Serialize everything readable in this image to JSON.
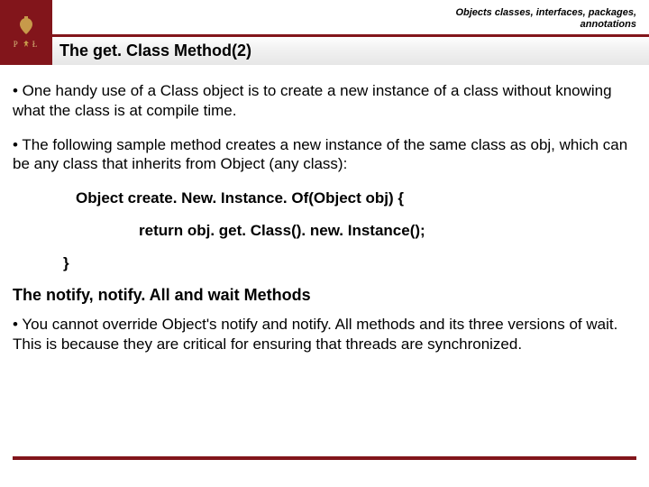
{
  "header": {
    "breadcrumb_line1": "Objects classes, interfaces, packages,",
    "breadcrumb_line2": "annotations",
    "title": "The get. Class Method(2)",
    "logo_letter_left": "P",
    "logo_letter_right": "Ł"
  },
  "body": {
    "para1": "• One handy use of a Class object is to create a new instance of a class without knowing what the class is at compile time.",
    "para2": "• The following sample method creates a new instance of the same class as obj, which can be any class that inherits from Object (any class):",
    "code_line1": "Object create. New. Instance. Of(Object obj) {",
    "code_line2": "return obj. get. Class(). new. Instance();",
    "code_line3": "}",
    "subhead": "The notify, notify. All and wait Methods",
    "para3": "• You cannot override Object's notify and notify. All methods and its three versions of wait. This is because they are critical for ensuring that threads are synchronized."
  }
}
